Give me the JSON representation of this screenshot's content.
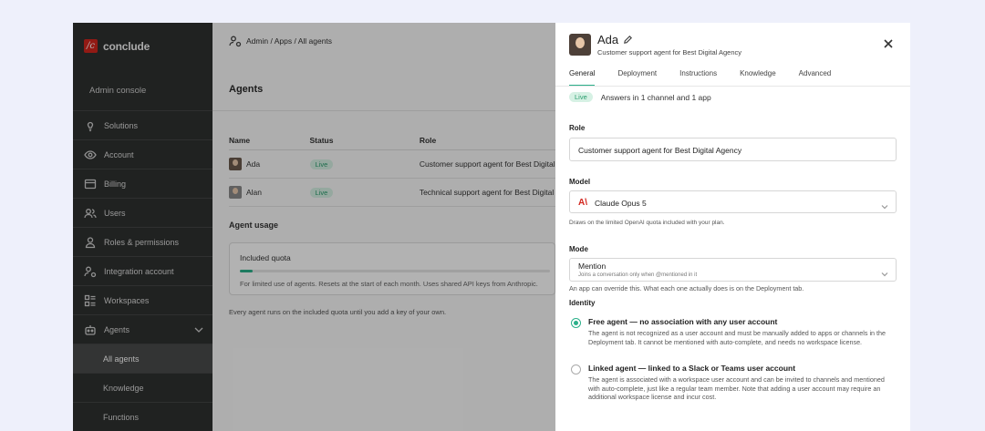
{
  "sidebar": {
    "brand_logo": "/c",
    "brand_name": "conclude",
    "console_label": "Admin console",
    "items": [
      {
        "label": "Solutions",
        "icon": "lightbulb-icon"
      },
      {
        "label": "Account",
        "icon": "eye-icon"
      },
      {
        "label": "Billing",
        "icon": "billing-icon"
      },
      {
        "label": "Users",
        "icon": "users-icon"
      },
      {
        "label": "Roles & permissions",
        "icon": "person-icon"
      },
      {
        "label": "Integration account",
        "icon": "integration-icon"
      },
      {
        "label": "Workspaces",
        "icon": "workspaces-icon"
      },
      {
        "label": "Agents",
        "icon": "robot-icon"
      }
    ],
    "sub_items": [
      {
        "label": "All agents",
        "active": true
      },
      {
        "label": "Knowledge"
      },
      {
        "label": "Functions"
      }
    ]
  },
  "main": {
    "breadcrumb": "Admin / Apps / All agents",
    "title": "Agents",
    "table": {
      "headers": [
        "Name",
        "Status",
        "Role"
      ],
      "rows": [
        {
          "name": "Ada",
          "status": "Live",
          "role": "Customer support agent for Best Digital Agency"
        },
        {
          "name": "Alan",
          "status": "Live",
          "role": "Technical support agent for Best Digital Agency"
        }
      ]
    },
    "usage": {
      "title": "Agent usage",
      "card_label": "Included quota",
      "progress": 0.04,
      "description": "For limited use of agents. Resets at the start of each month. Uses shared API keys from Anthropic.",
      "note": "Every agent runs on the included quota until you add a key of your own."
    }
  },
  "panel": {
    "name": "Ada",
    "subtitle": "Customer support agent for Best Digital Agency",
    "tabs": [
      "General",
      "Deployment",
      "Instructions",
      "Knowledge",
      "Advanced"
    ],
    "live_badge": "Live",
    "live_text": "Answers in 1 channel and 1 app",
    "role_label": "Role",
    "role_value": "Customer support agent for Best Digital Agency",
    "model_label": "Model",
    "model_icon": "A\\",
    "model_value": "Claude Opus 5",
    "model_hint": "Draws on the limited OpenAI quota included with your plan.",
    "mode_label": "Mode",
    "mode_value": "Mention",
    "mode_sub": "Joins a conversation only when @mentioned in it",
    "mode_hint": "An app can override this. What each one actually does is on the Deployment tab.",
    "identity_label": "Identity",
    "identity_options": [
      {
        "title": "Free agent — no association with any user account",
        "desc": "The agent is not recognized as a user account and must be manually added to apps or channels in the Deployment tab. It cannot be mentioned with auto-complete, and needs no workspace license.",
        "selected": true
      },
      {
        "title": "Linked agent — linked to a Slack or Teams user account",
        "desc": "The agent is associated with a workspace user account and can be invited to channels and mentioned with auto-complete, just like a regular team member. Note that adding a user account may require an additional workspace license and incur cost.",
        "selected": false
      }
    ]
  },
  "colors": {
    "accent": "#2bb08a",
    "brand": "#d2261e",
    "sidebar_bg": "#2f3130"
  }
}
